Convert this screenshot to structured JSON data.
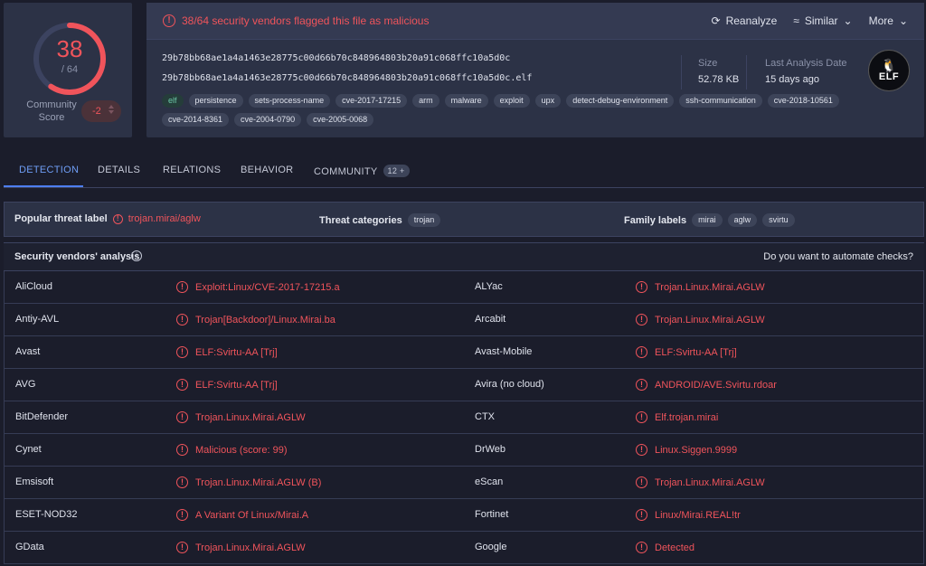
{
  "score": {
    "detections": "38",
    "total": "/ 64",
    "detection_ratio": 0.59375,
    "community_label": "Community Score",
    "community_value": "-2"
  },
  "alert": {
    "text": "38/64 security vendors flagged this file as malicious",
    "actions": [
      {
        "label": "Reanalyze",
        "icon": "refresh-icon"
      },
      {
        "label": "Similar",
        "icon": "similar-icon"
      },
      {
        "label": "More",
        "icon": "chevron-down-icon"
      }
    ]
  },
  "file": {
    "hash": "29b78bb68ae1a4a1463e28775c00d66b70c848964803b20a91c068ffc10a5d0c",
    "name": "29b78bb68ae1a4a1463e28775c00d66b70c848964803b20a91c068ffc10a5d0c.elf",
    "size_label": "Size",
    "size": "52.78 KB",
    "date_label": "Last Analysis Date",
    "date": "15 days ago",
    "type_badge": "ELF",
    "tags": [
      "elf",
      "persistence",
      "sets-process-name",
      "cve-2017-17215",
      "arm",
      "malware",
      "exploit",
      "upx",
      "detect-debug-environment",
      "ssh-communication",
      "cve-2018-10561",
      "cve-2014-8361",
      "cve-2004-0790",
      "cve-2005-0068"
    ]
  },
  "tabs": [
    {
      "label": "DETECTION",
      "active": true
    },
    {
      "label": "DETAILS"
    },
    {
      "label": "RELATIONS"
    },
    {
      "label": "BEHAVIOR"
    },
    {
      "label": "COMMUNITY",
      "badge": "12 +"
    }
  ],
  "threat": {
    "popular_label": "Popular threat label",
    "popular_value": "trojan.mirai/aglw",
    "categories_label": "Threat categories",
    "categories": [
      "trojan"
    ],
    "family_label": "Family labels",
    "families": [
      "mirai",
      "aglw",
      "svirtu"
    ]
  },
  "vendors": {
    "title": "Security vendors' analysis",
    "automate": "Do you want to automate checks?",
    "rows": [
      {
        "v1": "AliCloud",
        "r1": "Exploit:Linux/CVE-2017-17215.a",
        "v2": "ALYac",
        "r2": "Trojan.Linux.Mirai.AGLW"
      },
      {
        "v1": "Antiy-AVL",
        "r1": "Trojan[Backdoor]/Linux.Mirai.ba",
        "v2": "Arcabit",
        "r2": "Trojan.Linux.Mirai.AGLW"
      },
      {
        "v1": "Avast",
        "r1": "ELF:Svirtu-AA [Trj]",
        "v2": "Avast-Mobile",
        "r2": "ELF:Svirtu-AA [Trj]"
      },
      {
        "v1": "AVG",
        "r1": "ELF:Svirtu-AA [Trj]",
        "v2": "Avira (no cloud)",
        "r2": "ANDROID/AVE.Svirtu.rdoar"
      },
      {
        "v1": "BitDefender",
        "r1": "Trojan.Linux.Mirai.AGLW",
        "v2": "CTX",
        "r2": "Elf.trojan.mirai"
      },
      {
        "v1": "Cynet",
        "r1": "Malicious (score: 99)",
        "v2": "DrWeb",
        "r2": "Linux.Siggen.9999"
      },
      {
        "v1": "Emsisoft",
        "r1": "Trojan.Linux.Mirai.AGLW (B)",
        "v2": "eScan",
        "r2": "Trojan.Linux.Mirai.AGLW"
      },
      {
        "v1": "ESET-NOD32",
        "r1": "A Variant Of Linux/Mirai.A",
        "v2": "Fortinet",
        "r2": "Linux/Mirai.REAL!tr"
      },
      {
        "v1": "GData",
        "r1": "Trojan.Linux.Mirai.AGLW",
        "v2": "Google",
        "r2": "Detected"
      }
    ]
  },
  "colors": {
    "malicious": "#f0545b",
    "accent": "#4d7ef0",
    "panel": "#2c3246",
    "bg": "#1b1d2b"
  }
}
